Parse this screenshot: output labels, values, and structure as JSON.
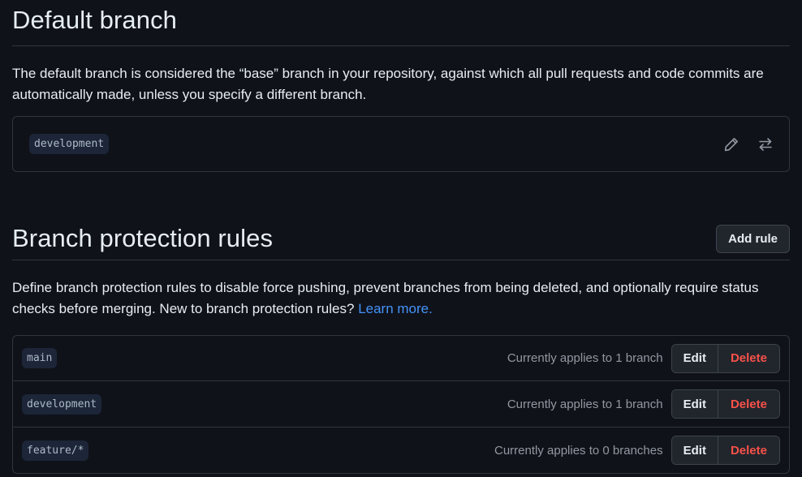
{
  "default_branch": {
    "title": "Default branch",
    "description": "The default branch is considered the “base” branch in your repository, against which all pull requests and code commits are automatically made, unless you specify a different branch.",
    "branch": "development",
    "edit_icon": "pencil-icon",
    "switch_icon": "arrow-switch-icon"
  },
  "protection": {
    "title": "Branch protection rules",
    "add_rule_label": "Add rule",
    "description": "Define branch protection rules to disable force pushing, prevent branches from being deleted, and optionally require status checks before merging. New to branch protection rules?",
    "learn_more": "Learn more.",
    "rules": [
      {
        "pattern": "main",
        "applies": "Currently applies to 1 branch",
        "edit": "Edit",
        "delete": "Delete"
      },
      {
        "pattern": "development",
        "applies": "Currently applies to 1 branch",
        "edit": "Edit",
        "delete": "Delete"
      },
      {
        "pattern": "feature/*",
        "applies": "Currently applies to 0 branches",
        "edit": "Edit",
        "delete": "Delete"
      }
    ]
  },
  "colors": {
    "background": "#10121a",
    "border": "#30363d",
    "link": "#4493f8",
    "danger": "#f85149"
  }
}
